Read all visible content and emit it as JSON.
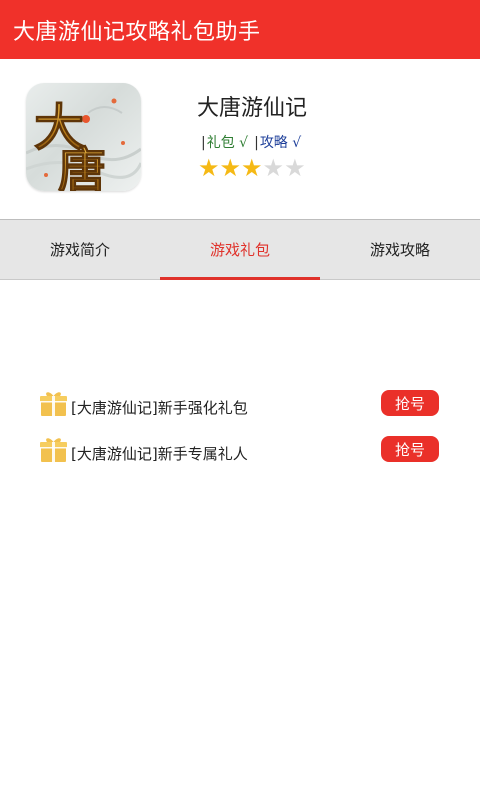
{
  "app_title": "大唐游仙记攻略礼包助手",
  "game": {
    "name": "大唐游仙记",
    "icon_text": "大唐",
    "tags": [
      {
        "label": "礼包 √",
        "color": "#2e7d32"
      },
      {
        "label": "攻略 √",
        "color": "#1e3f9a"
      }
    ],
    "rating": 3,
    "rating_max": 5
  },
  "tabs": [
    {
      "label": "游戏简介",
      "active": false
    },
    {
      "label": "游戏礼包",
      "active": true
    },
    {
      "label": "游戏攻略",
      "active": false
    }
  ],
  "gifts": [
    {
      "name": "[大唐游仙记]新手强化礼包",
      "button": "抢号"
    },
    {
      "name": "[大唐游仙记]新手专属礼人",
      "button": "抢号"
    }
  ],
  "colors": {
    "accent": "#f0312a",
    "star_on": "#f5b915",
    "star_off": "#d9d9d9",
    "gift_icon": "#f2c14e"
  }
}
